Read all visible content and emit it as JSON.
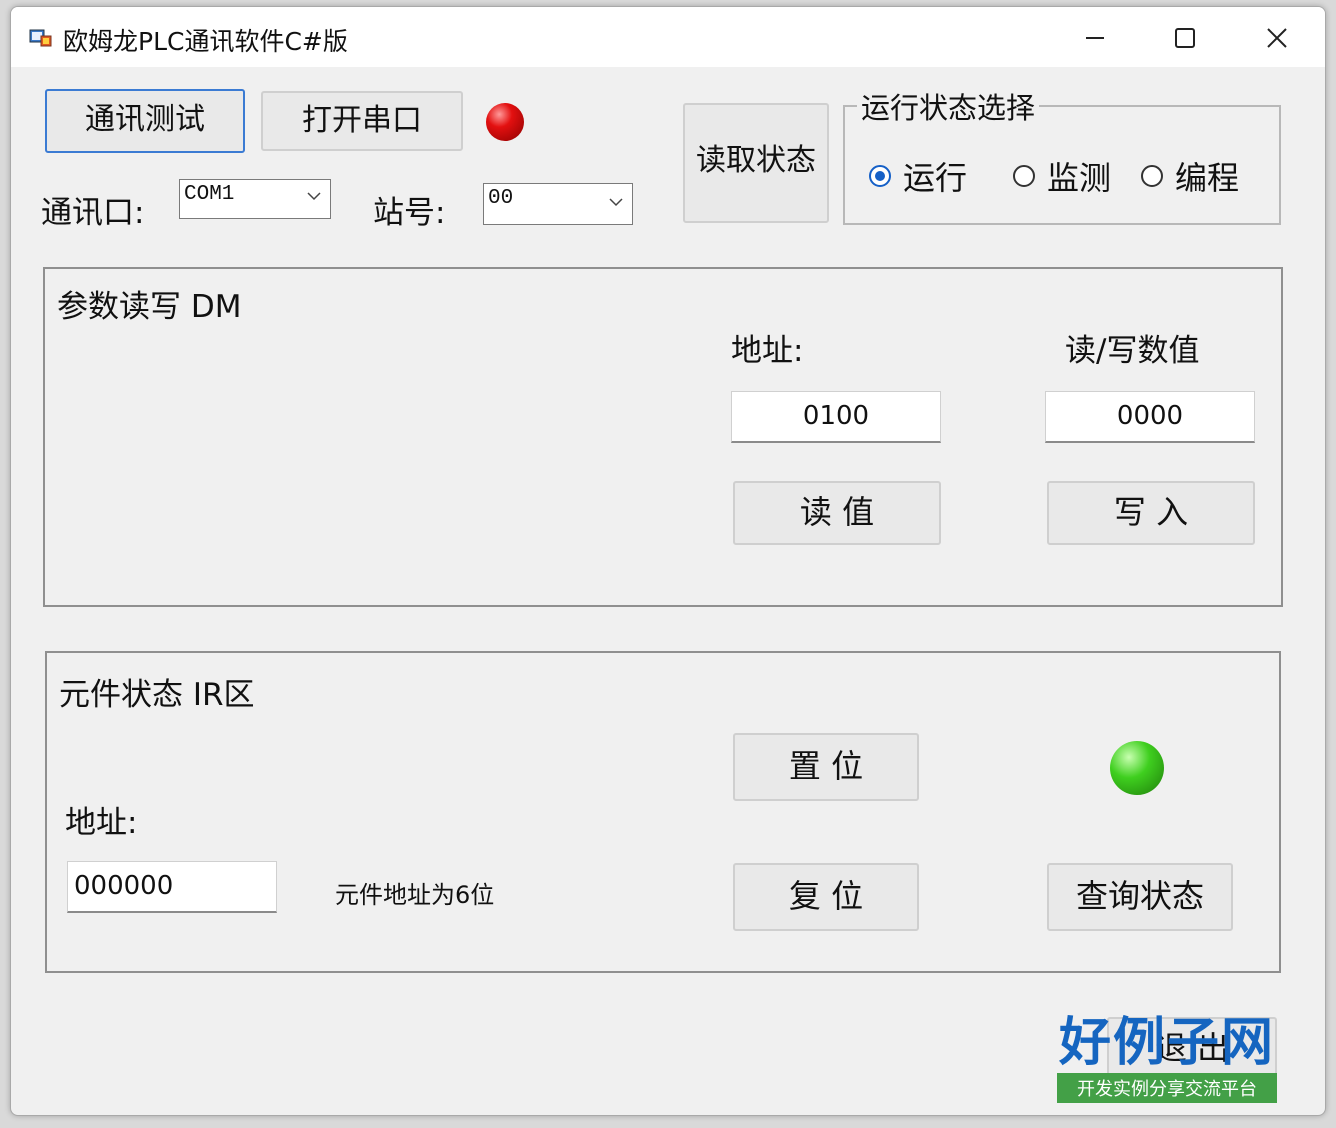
{
  "window": {
    "title": "欧姆龙PLC通讯软件C#版",
    "minimize_glyph": "—",
    "maximize_glyph": "☐",
    "close_glyph": "✕"
  },
  "top": {
    "comm_test_button": "通讯测试",
    "open_port_button": "打开串口",
    "port_label": "通讯口:",
    "port_value": "COM1",
    "station_label": "站号:",
    "station_value": "00",
    "read_status_button": "读取状态",
    "port_led_color": "#d10000"
  },
  "run_state": {
    "title": "运行状态选择",
    "options": [
      {
        "label": "运行",
        "checked": true
      },
      {
        "label": "监测",
        "checked": false
      },
      {
        "label": "编程",
        "checked": false
      }
    ]
  },
  "dm_group": {
    "title": "参数读写 DM",
    "address_label": "地址:",
    "value_label": "读/写数值",
    "address_value": "0100",
    "value_value": "0000",
    "read_button": "读 值",
    "write_button": "写 入"
  },
  "ir_group": {
    "title": "元件状态 IR区",
    "address_label": "地址:",
    "address_value": "000000",
    "hint": "元件地址为6位",
    "set_button": "置 位",
    "reset_button": "复 位",
    "query_button": "查询状态",
    "status_led_color": "#3fcf1f"
  },
  "exit_button": "退 出",
  "watermark": {
    "main": "好例子网",
    "sub": "开发实例分享交流平台"
  }
}
